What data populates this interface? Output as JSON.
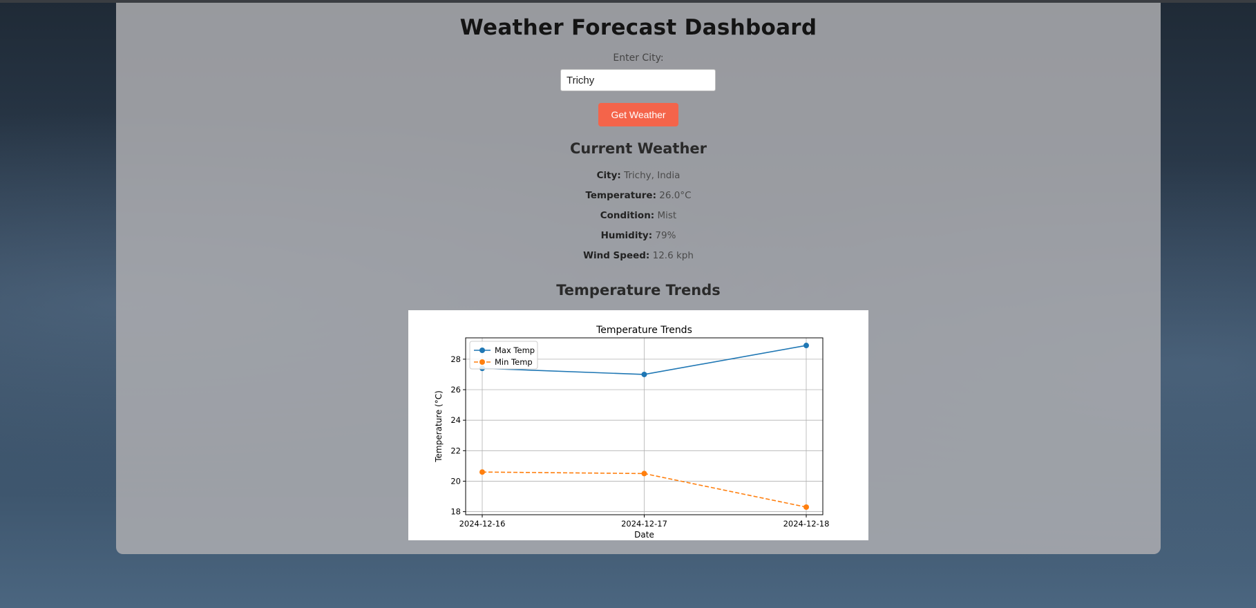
{
  "app": {
    "title": "Weather Forecast Dashboard"
  },
  "search": {
    "label": "Enter City:",
    "value": "Trichy",
    "button_label": "Get Weather"
  },
  "current": {
    "heading": "Current Weather",
    "rows": [
      {
        "label": "City:",
        "value": "Trichy, India"
      },
      {
        "label": "Temperature:",
        "value": "26.0°C"
      },
      {
        "label": "Condition:",
        "value": "Mist"
      },
      {
        "label": "Humidity:",
        "value": "79%"
      },
      {
        "label": "Wind Speed:",
        "value": "12.6 kph"
      }
    ]
  },
  "trends": {
    "heading": "Temperature Trends"
  },
  "chart_data": {
    "type": "line",
    "title": "Temperature Trends",
    "xlabel": "Date",
    "ylabel": "Temperature (°C)",
    "categories": [
      "2024-12-16",
      "2024-12-17",
      "2024-12-18"
    ],
    "series": [
      {
        "name": "Max Temp",
        "values": [
          27.4,
          27.0,
          28.9
        ],
        "color": "#1f77b4",
        "style": "solid",
        "marker": "circle"
      },
      {
        "name": "Min Temp",
        "values": [
          20.6,
          20.5,
          18.3
        ],
        "color": "#ff7f0e",
        "style": "dashed",
        "marker": "circle"
      }
    ],
    "ylim": [
      17.8,
      29.4
    ],
    "yticks": [
      18,
      20,
      22,
      24,
      26,
      28
    ],
    "grid": true,
    "legend_position": "top-left"
  }
}
